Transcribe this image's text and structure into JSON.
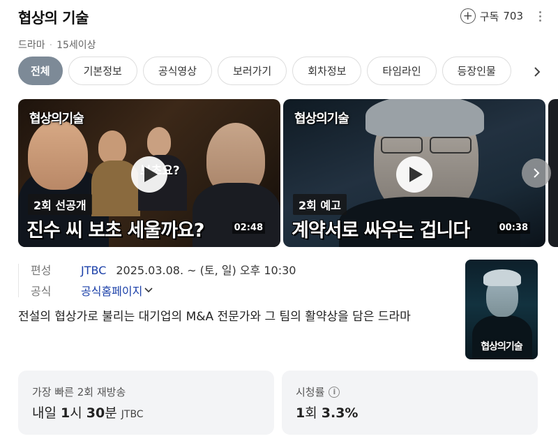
{
  "header": {
    "title": "협상의 기술",
    "genre": "드라마",
    "rating": "15세이상",
    "subscribe_label": "구독",
    "subscribe_count": "703"
  },
  "tabs": [
    {
      "label": "전체",
      "active": true
    },
    {
      "label": "기본정보",
      "active": false
    },
    {
      "label": "공식영상",
      "active": false
    },
    {
      "label": "보러가기",
      "active": false
    },
    {
      "label": "회차정보",
      "active": false
    },
    {
      "label": "타임라인",
      "active": false
    },
    {
      "label": "등장인물",
      "active": false
    }
  ],
  "videos": [
    {
      "logo": "협상의기술",
      "tag": "2회 선공개",
      "caption": "진수 씨 보초 세울까요?",
      "overlay_text": "보초요?",
      "duration": "02:48"
    },
    {
      "logo": "협상의기술",
      "tag": "2회 예고",
      "caption": "계약서로 싸우는 겁니다",
      "duration": "00:38"
    }
  ],
  "info": {
    "broadcast_label": "편성",
    "network": "JTBC",
    "schedule": "2025.03.08. ~  (토, 일) 오후 10:30",
    "official_label": "공식",
    "homepage_link": "공식홈페이지"
  },
  "description": "전설의 협상가로 불리는 대기업의 M&A 전문가와 그 팀의 활약상을 담은 드라마",
  "poster": {
    "title": "협상의기술"
  },
  "rerun": {
    "label": "가장 빠른 2회 재방송",
    "day": "내일",
    "hour": "1",
    "hour_unit": "시",
    "minute": "30",
    "minute_unit": "분",
    "network": "JTBC"
  },
  "ratings": {
    "label": "시청률",
    "episode": "1",
    "episode_unit": "회",
    "value": "3.3%"
  },
  "colors": {
    "active_tab": "#7d8a97",
    "link": "#1a3fa8",
    "card_bg": "#f3f4f6"
  }
}
